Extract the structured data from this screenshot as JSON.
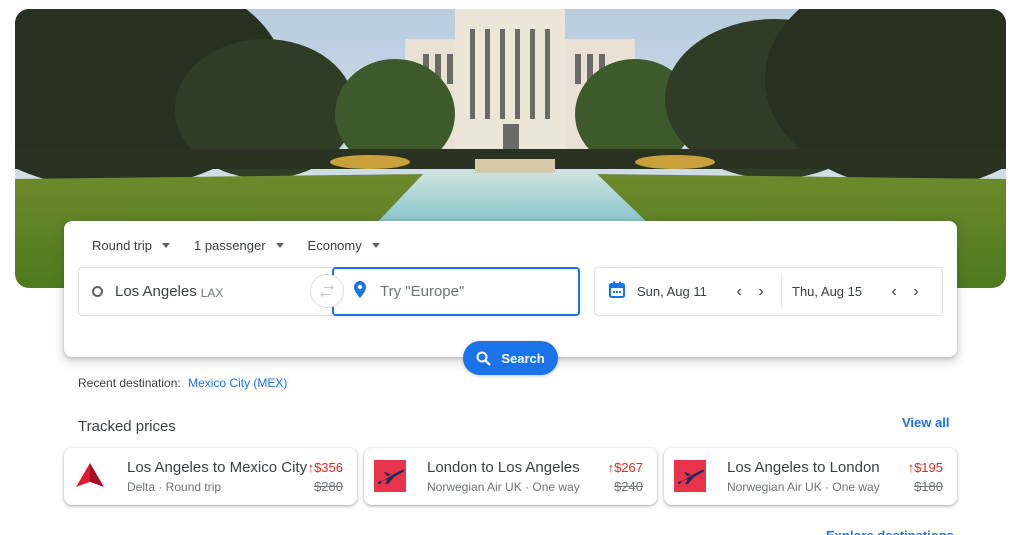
{
  "hero": {
    "alt": "City hall building with reflecting pool and trees"
  },
  "search": {
    "trip_type": "Round trip",
    "passengers": "1 passenger",
    "cabin_class": "Economy",
    "origin": {
      "city": "Los Angeles",
      "code": "LAX"
    },
    "destination": {
      "placeholder": "Try \"Europe\""
    },
    "depart_date": "Sun, Aug 11",
    "return_date": "Thu, Aug 15",
    "search_label": "Search",
    "prev_glyph": "‹",
    "next_glyph": "›"
  },
  "recent": {
    "label": "Recent destination:",
    "destination": "Mexico City (MEX)"
  },
  "tracked": {
    "title": "Tracked prices",
    "view_all": "View all",
    "items": [
      {
        "route": "Los Angeles to Mexico City",
        "details": "Delta · Round trip",
        "price": "↑$356",
        "old_price": "$280",
        "logo": "delta-logo"
      },
      {
        "route": "London to Los Angeles",
        "details": "Norwegian Air UK · One way",
        "price": "↑$267",
        "old_price": "$240",
        "logo": "norwegian-logo"
      },
      {
        "route": "Los Angeles to London",
        "details": "Norwegian Air UK · One way",
        "price": "↑$195",
        "old_price": "$180",
        "logo": "norwegian-logo"
      }
    ]
  },
  "footer": {
    "explore": "Explore destinations"
  },
  "colors": {
    "accent": "#1a73e8",
    "price_up": "#d93025",
    "delta_red": "#c8102e",
    "norwegian_red": "#e8344a",
    "norwegian_navy": "#1d2a5a"
  }
}
